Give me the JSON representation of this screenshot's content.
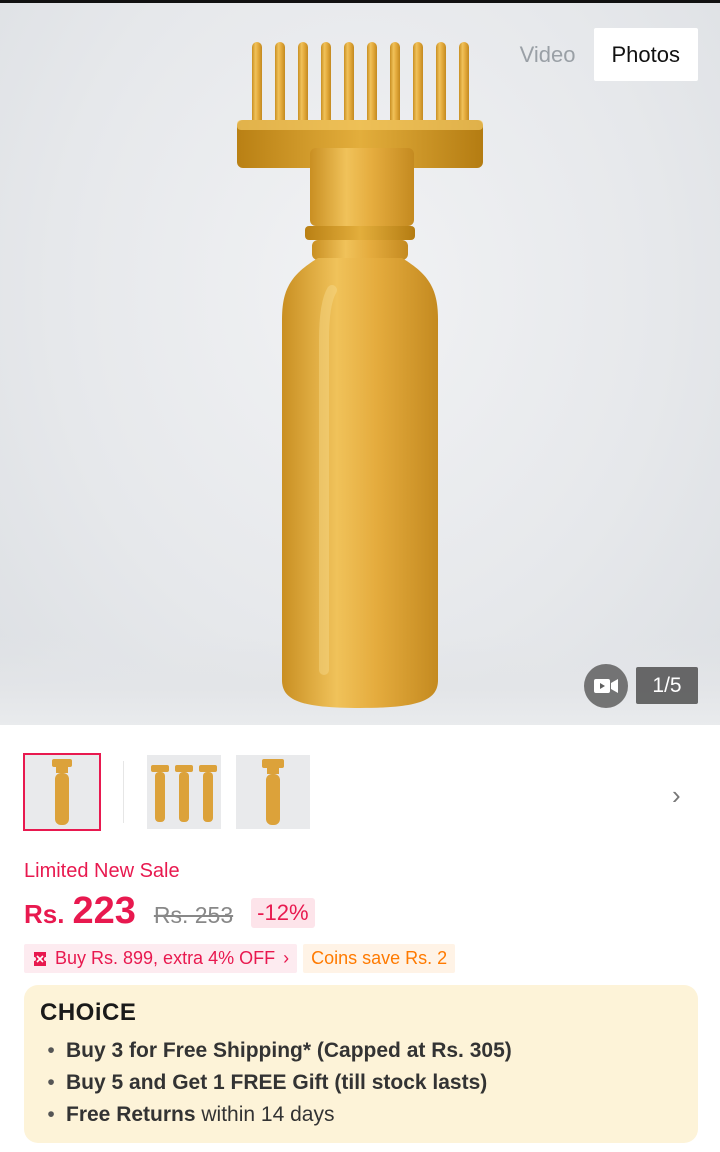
{
  "gallery": {
    "tabs": [
      {
        "label": "Video",
        "active": false
      },
      {
        "label": "Photos",
        "active": true
      }
    ],
    "counter": "1/5",
    "video_icon": "video-camera-icon",
    "product_color": "#e0a73a"
  },
  "thumbnails": [
    {
      "selected": true,
      "count": 1
    },
    {
      "selected": false,
      "count": 3
    },
    {
      "selected": false,
      "count": 1
    }
  ],
  "pricing": {
    "sale_label": "Limited New Sale",
    "currency": "Rs.",
    "amount": "223",
    "original_price": "Rs. 253",
    "discount": "-12%"
  },
  "promos": {
    "offer": "Buy Rs. 899, extra 4% OFF",
    "coins": "Coins save Rs. 2"
  },
  "choice": {
    "logo": "CHOiCE",
    "items": [
      {
        "bold": "Buy 3 for  Free Shipping* (Capped at Rs. 305)",
        "rest": ""
      },
      {
        "bold": "Buy 5 and Get 1 FREE Gift (till stock lasts)",
        "rest": ""
      },
      {
        "bold": "Free Returns",
        "rest": " within 14 days"
      }
    ]
  },
  "colors": {
    "accent": "#e8194f",
    "coins": "#ff7a00",
    "choice_bg": "#fdf3d8"
  }
}
